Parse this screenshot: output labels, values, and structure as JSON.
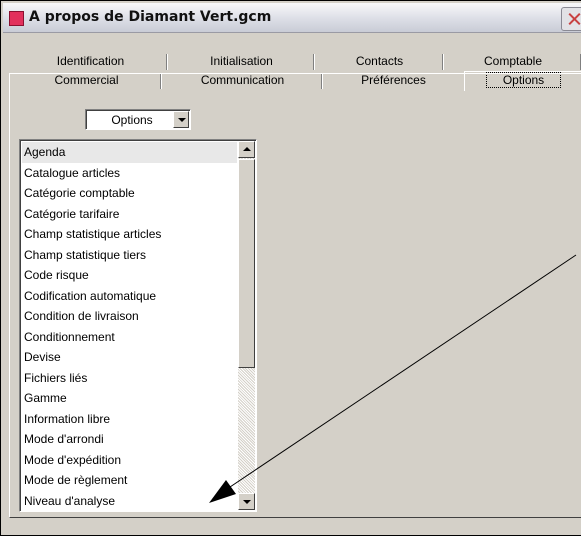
{
  "window": {
    "title": "A propos de Diamant Vert.gcm"
  },
  "tabs_row1": [
    {
      "label": "Identification"
    },
    {
      "label": "Initialisation"
    },
    {
      "label": "Contacts"
    },
    {
      "label": "Comptable"
    }
  ],
  "tabs_row2": [
    {
      "label": "Commercial"
    },
    {
      "label": "Communication"
    },
    {
      "label": "Préférences"
    },
    {
      "label": "Options"
    }
  ],
  "active_tab": "Options",
  "combo": {
    "value": "Options"
  },
  "list": {
    "selected": "Agenda",
    "items": [
      "Agenda",
      "Catalogue articles",
      "Catégorie comptable",
      "Catégorie tarifaire",
      "Champ statistique articles",
      "Champ statistique tiers",
      "Code risque",
      "Codification automatique",
      "Condition de livraison",
      "Conditionnement",
      "Devise",
      "Fichiers liés",
      "Gamme",
      "Information libre",
      "Mode d'arrondi",
      "Mode d'expédition",
      "Mode de règlement",
      "Niveau d'analyse"
    ]
  },
  "icons": {
    "app": "app-icon",
    "close": "close-icon",
    "combo_arrow": "chevron-down-icon",
    "scroll_up": "scroll-up-icon",
    "scroll_down": "scroll-down-icon",
    "annotation": "arrow-annotation"
  },
  "colors": {
    "dialog_background": "#d4d0c8",
    "app_icon": "#e2305c",
    "close_x": "#c84040"
  }
}
